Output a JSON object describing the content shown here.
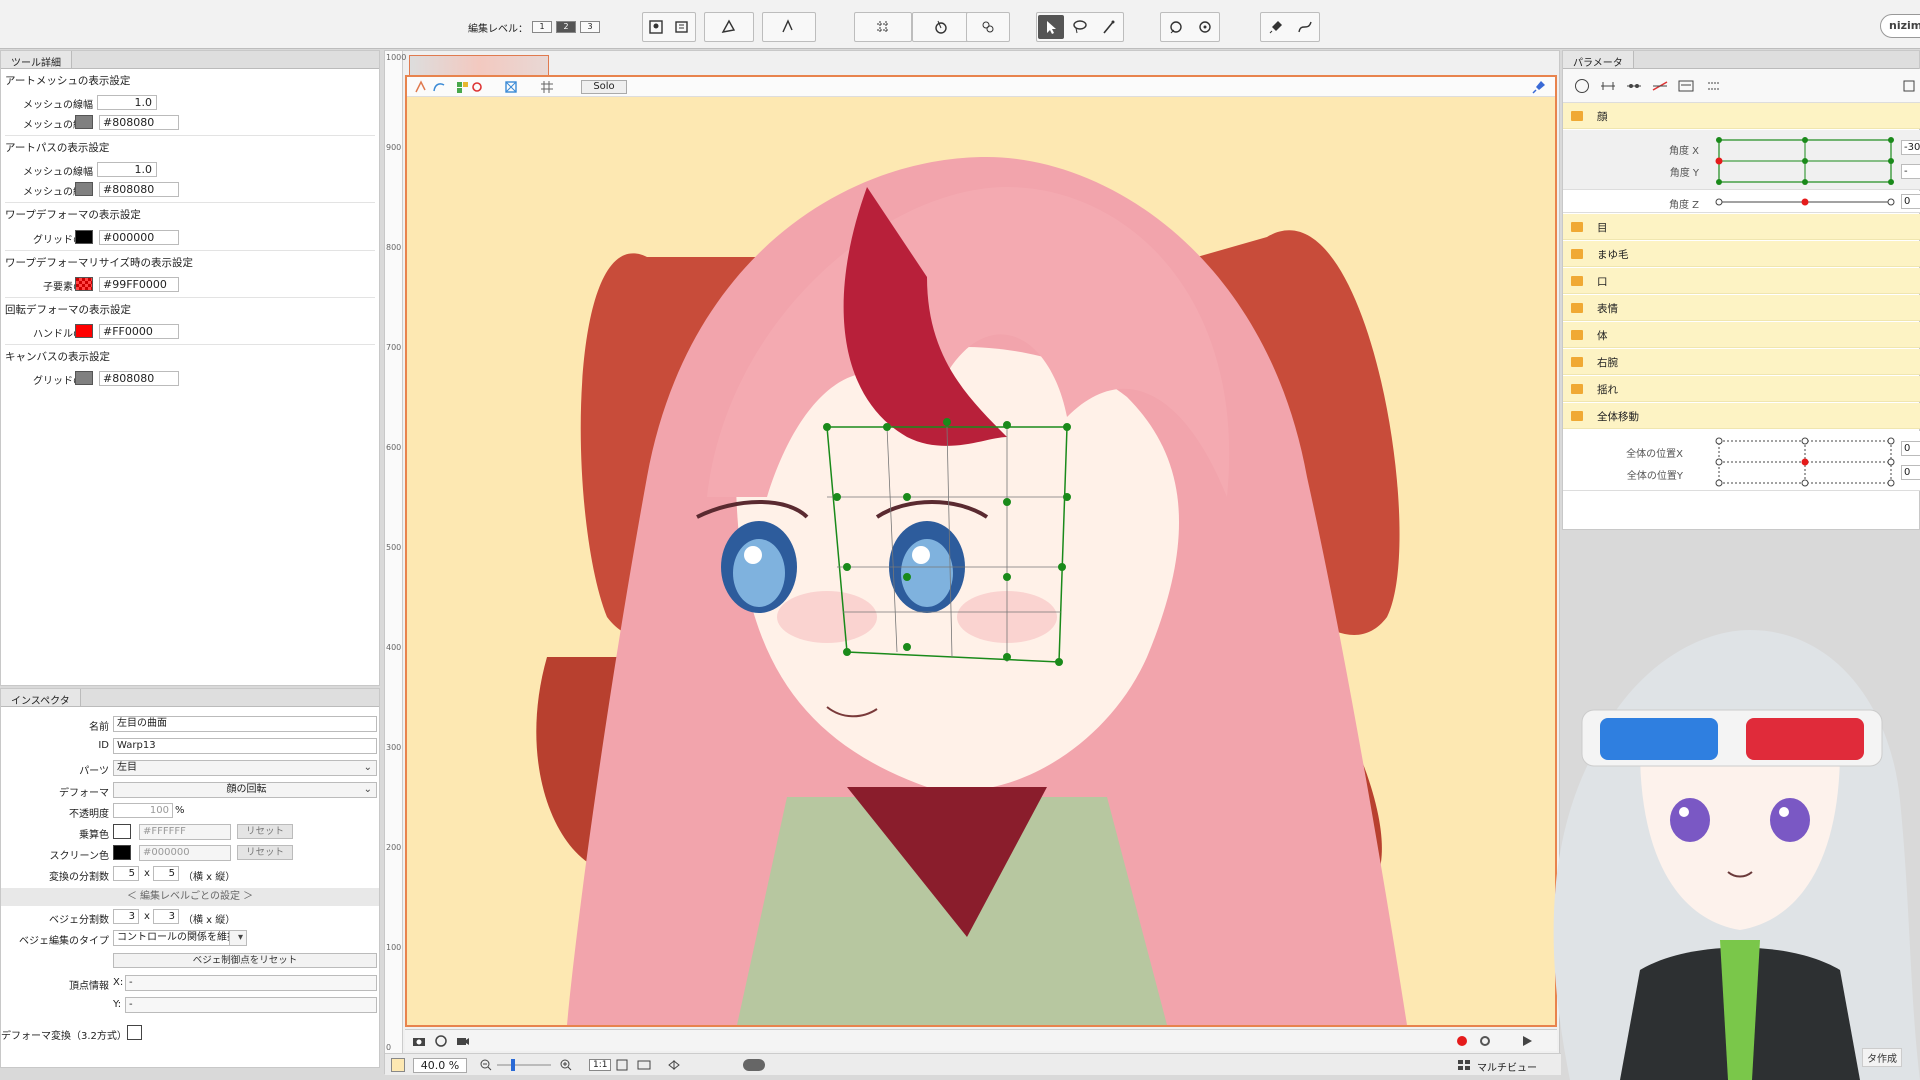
{
  "toolbar": {
    "edit_level_label": "編集レベル：",
    "edit_levels": [
      "1",
      "2",
      "3"
    ],
    "active_level": "2",
    "logo_text": "nizim"
  },
  "tool_details": {
    "tab": "ツール詳細",
    "art_mesh": {
      "title": "アートメッシュの表示設定",
      "width_label": "メッシュの線幅",
      "width": "1.0",
      "color_label": "メッシュの線色",
      "color": "#808080"
    },
    "art_path": {
      "title": "アートパスの表示設定",
      "width_label": "メッシュの線幅",
      "width": "1.0",
      "color_label": "メッシュの線色",
      "color": "#808080"
    },
    "warp": {
      "title": "ワープデフォーマの表示設定",
      "grid_label": "グリッドの色",
      "grid": "#000000"
    },
    "warp_resize": {
      "title": "ワープデフォーマリサイズ時の表示設定",
      "child_label": "子要素の色",
      "child": "#99FF0000"
    },
    "rotation": {
      "title": "回転デフォーマの表示設定",
      "handle_label": "ハンドルの色",
      "handle": "#FF0000"
    },
    "canvas": {
      "title": "キャンバスの表示設定",
      "grid_label": "グリッドの色",
      "grid": "#808080"
    }
  },
  "inspector": {
    "tab": "インスペクタ",
    "name_label": "名前",
    "name": "左目の曲面",
    "id_label": "ID",
    "id": "Warp13",
    "parts_label": "パーツ",
    "parts": "左目",
    "deformer_label": "デフォーマ",
    "deformer": "顔の回転",
    "opacity_label": "不透明度",
    "opacity": "100",
    "percent": "%",
    "multiply_label": "乗算色",
    "multiply": "#FFFFFF",
    "reset": "リセット",
    "screen_label": "スクリーン色",
    "screen": "#000000",
    "division_label": "変換の分割数",
    "div_x": "5",
    "div_y": "5",
    "x_sep": "x",
    "div_hint": "（横 x 縦）",
    "per_level": "＜ 編集レベルごとの設定 ＞",
    "bezier_div_label": "ベジェ分割数",
    "bezier_x": "3",
    "bezier_y": "3",
    "bezier_type_label": "ベジェ編集のタイプ",
    "bezier_type": "コントロールの関係を維持",
    "bezier_reset": "ベジェ制御点をリセット",
    "vertex_label": "頂点情報",
    "vx_label": "X:",
    "vx": "-",
    "vy_label": "Y:",
    "vy": "-",
    "deform_label": "デフォーマ変換（3.2方式）"
  },
  "canvas": {
    "solo": "Solo",
    "ruler": [
      "1000",
      "900",
      "800",
      "700",
      "600",
      "500",
      "400",
      "300",
      "200",
      "100",
      "0"
    ],
    "zoom": "40.0 %",
    "ratio": "1:1",
    "multi_view": "マルチビュー"
  },
  "parameters": {
    "tab": "パラメータ",
    "face": "顔",
    "angle_x": "角度 X",
    "angle_x_val": "-30",
    "angle_y": "角度 Y",
    "angle_y_val": "-",
    "angle_z": "角度 Z",
    "angle_z_val": "0",
    "folders": [
      "目",
      "まゆ毛",
      "口",
      "表情",
      "体",
      "右腕",
      "揺れ",
      "全体移動"
    ],
    "pos_x": "全体の位置X",
    "pos_y": "全体の位置Y",
    "pos_x_val": "0",
    "pos_y_val": "0"
  },
  "corner_label": "タ作成",
  "colors": {
    "accent": "#e8834d",
    "canvas_bg": "#fde8b2",
    "mesh_green": "#1a8a1a",
    "folder": "#fdf3c4"
  }
}
